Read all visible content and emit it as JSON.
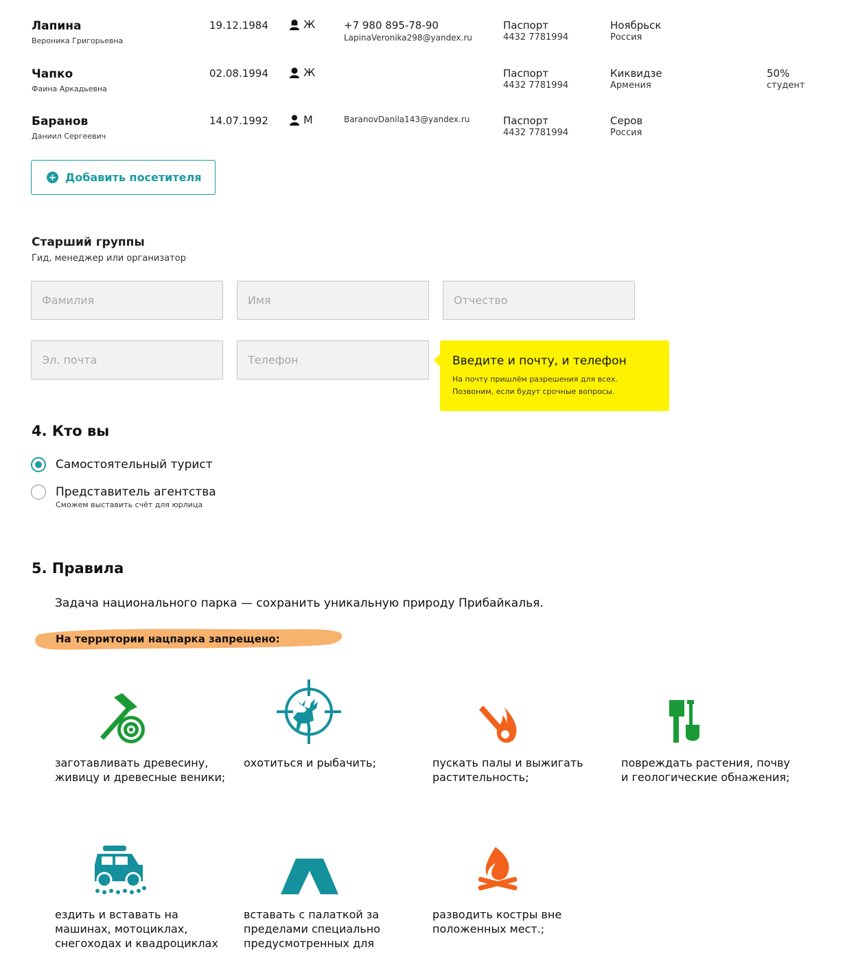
{
  "visitors": [
    {
      "surname": "Лапина",
      "fullname": "Вероника Григорьевна",
      "birthdate": "19.12.1984",
      "gender": "Ж",
      "gender_icon": "female-person-icon",
      "phone": "+7 980 895-78-90",
      "email": "LapinaVeronika298@yandex.ru",
      "doc_type": "Паспорт",
      "doc_number": "4432 7781994",
      "city": "Ноябрьск",
      "country": "Россия",
      "discount": "",
      "discount_label": ""
    },
    {
      "surname": "Чапко",
      "fullname": "Фаина Аркадьевна",
      "birthdate": "02.08.1994",
      "gender": "Ж",
      "gender_icon": "female-person-icon",
      "phone": "",
      "email": "",
      "doc_type": "Паспорт",
      "doc_number": "4432 7781994",
      "city": "Киквидзе",
      "country": "Армения",
      "discount": "50%",
      "discount_label": "студент"
    },
    {
      "surname": "Баранов",
      "fullname": "Даниил Сергеевич",
      "birthdate": "14.07.1992",
      "gender": "М",
      "gender_icon": "male-person-icon",
      "phone": "",
      "email": "BaranovDanila143@yandex.ru",
      "doc_type": "Паспорт",
      "doc_number": "4432 7781994",
      "city": "Серов",
      "country": "Россия",
      "discount": "",
      "discount_label": ""
    }
  ],
  "add_visitor": {
    "label": "Добавить посетителя",
    "icon": "plus-circle-icon"
  },
  "group_leader": {
    "title": "Старший группы",
    "subtitle": "Гид, менеджер или организатор",
    "fields": {
      "surname_placeholder": "Фамилия",
      "name_placeholder": "Имя",
      "patronymic_placeholder": "Отчество",
      "email_placeholder": "Эл. почта",
      "phone_placeholder": "Телефон"
    },
    "tooltip": {
      "title": "Введите и почту, и телефон",
      "text": "На почту пришлём разрешения для всех. Позвоним, если будут срочные вопросы."
    }
  },
  "who": {
    "title": "4. Кто вы",
    "options": [
      {
        "label": "Самостоятельный турист",
        "sub": "",
        "checked": true
      },
      {
        "label": "Представитель агентства",
        "sub": "Сможем выставить счёт для юрлица",
        "checked": false
      }
    ]
  },
  "rules": {
    "title": "5. Правила",
    "intro": "Задача национального парка — сохранить уникальную природу Прибайкалья.",
    "banner": "На территории нацпарка запрещено:",
    "items": [
      {
        "text": "заготавливать древесину, живицу и древесные веники;",
        "icon": "axe-log-icon"
      },
      {
        "text": "охотиться и рыбачить;",
        "icon": "deer-target-icon"
      },
      {
        "text": "пускать палы и выжигать растительность;",
        "icon": "burning-match-icon"
      },
      {
        "text": "повреждать растения, почву и геологические обнажения;",
        "icon": "axe-shovel-icon"
      },
      {
        "text": "ездить и вставать на машинах, мотоциклах, снегоходах и квадроциклах",
        "icon": "offroad-car-icon"
      },
      {
        "text": "вставать с палаткой за пределами специально предусмотренных для",
        "icon": "tent-icon"
      },
      {
        "text": "разводить костры вне положенных мест.;",
        "icon": "campfire-icon"
      }
    ]
  },
  "colors": {
    "accent": "#1b9aa4",
    "tooltip_bg": "#fff200",
    "banner": "#f7b26d",
    "green": "#1a9a36",
    "orange": "#f2621c",
    "teal": "#15919d"
  }
}
